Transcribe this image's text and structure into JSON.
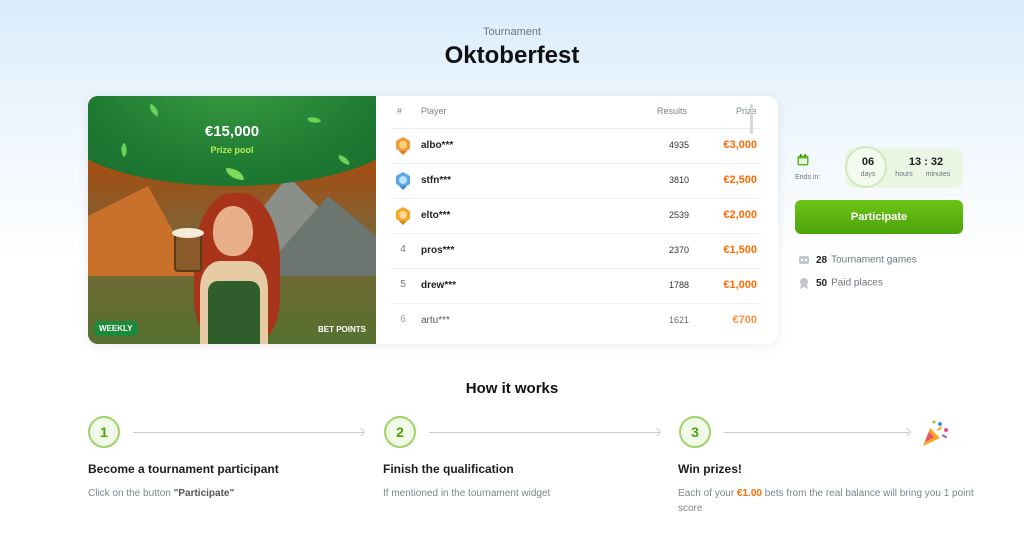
{
  "header": {
    "subtitle": "Tournament",
    "title": "Oktoberfest"
  },
  "banner": {
    "prize_amount": "€15,000",
    "prize_label": "Prize pool",
    "badge_weekly": "WEEKLY",
    "badge_bet": "BET POINTS"
  },
  "leaderboard": {
    "columns": {
      "rank": "#",
      "player": "Player",
      "results": "Results",
      "prize": "Prize"
    },
    "rows": [
      {
        "rank": "1",
        "player": "albo***",
        "result": "4935",
        "prize": "€3,000",
        "medal": "gold"
      },
      {
        "rank": "2",
        "player": "stfn***",
        "result": "3810",
        "prize": "€2,500",
        "medal": "silver"
      },
      {
        "rank": "3",
        "player": "elto***",
        "result": "2539",
        "prize": "€2,000",
        "medal": "bronze"
      },
      {
        "rank": "4",
        "player": "pros***",
        "result": "2370",
        "prize": "€1,500"
      },
      {
        "rank": "5",
        "player": "drew***",
        "result": "1788",
        "prize": "€1,000"
      },
      {
        "rank": "6",
        "player": "artu***",
        "result": "1621",
        "prize": "€700"
      }
    ]
  },
  "timer": {
    "ends_in": "Ends in:",
    "days": "06",
    "days_label": "days",
    "hm": "13 : 32",
    "hours_label": "hours",
    "minutes_label": "minutes"
  },
  "participate_label": "Participate",
  "stats": [
    {
      "value": "28",
      "label": "Tournament games",
      "icon": "gamepad-icon"
    },
    {
      "value": "50",
      "label": "Paid places",
      "icon": "medal-icon"
    }
  ],
  "how": {
    "title": "How it works",
    "steps": [
      {
        "num": "1",
        "title": "Become a tournament participant",
        "desc_prefix": "Click on the button ",
        "desc_bold": "\"Participate\""
      },
      {
        "num": "2",
        "title": "Finish the qualification",
        "desc": "If mentioned in the tournament widget"
      },
      {
        "num": "3",
        "title": "Win prizes!",
        "desc_prefix": "Each of your ",
        "desc_money": "€1.00",
        "desc_suffix": " bets from the real balance will bring you 1 point score"
      }
    ]
  },
  "colors": {
    "accent_green": "#4ea30b",
    "prize_orange": "#ff6b00"
  }
}
